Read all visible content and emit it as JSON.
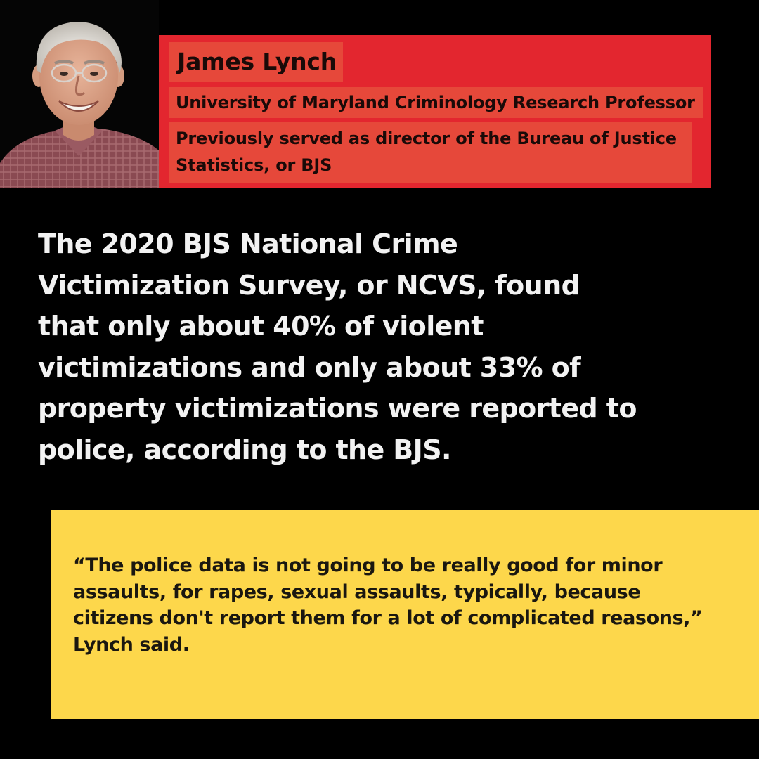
{
  "profile": {
    "name": "James Lynch",
    "title": "University of Maryland Criminology Research Professor",
    "previous_role_lines": [
      "Previously served as director of the Bureau of Justice",
      "Statistics, or BJS"
    ]
  },
  "main_text_lines": [
    "The 2020 BJS National Crime",
    "Victimization Survey, or NCVS, found",
    "that only about 40% of violent",
    "victimizations and only about 33% of",
    "property victimizations were reported to",
    "police, according to the BJS."
  ],
  "quote_lines": [
    "“The police data is not going to be really good for minor",
    "assaults, for rapes, sexual assaults, typically, because",
    "citizens don't report them for a lot of complicated reasons,”",
    "Lynch said."
  ],
  "colors": {
    "background": "#000000",
    "name_card": "#e3262f",
    "name_strip": "#e6483a",
    "quote_box": "#fdd74b",
    "main_text": "#f2f2f2"
  }
}
